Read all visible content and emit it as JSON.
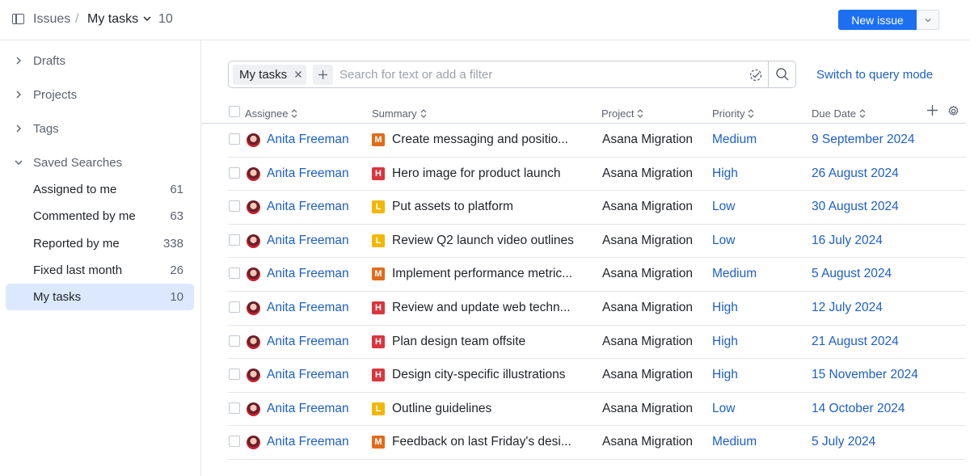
{
  "header": {
    "breadcrumb_root": "Issues",
    "breadcrumb_sep": "/",
    "current_view": "My tasks",
    "count": "10",
    "new_issue_label": "New issue"
  },
  "sidebar": {
    "groups": [
      {
        "label": "Drafts",
        "expanded": false
      },
      {
        "label": "Projects",
        "expanded": false
      },
      {
        "label": "Tags",
        "expanded": false
      },
      {
        "label": "Saved Searches",
        "expanded": true
      }
    ],
    "saved": [
      {
        "label": "Assigned to me",
        "count": "61"
      },
      {
        "label": "Commented by me",
        "count": "63"
      },
      {
        "label": "Reported by me",
        "count": "338"
      },
      {
        "label": "Fixed last month",
        "count": "26"
      },
      {
        "label": "My tasks",
        "count": "10",
        "active": true
      }
    ]
  },
  "search": {
    "chip_label": "My tasks",
    "placeholder": "Search for text or add a filter",
    "switch_mode_label": "Switch to query mode"
  },
  "table": {
    "columns": [
      "Assignee",
      "Summary",
      "Project",
      "Priority",
      "Due Date"
    ],
    "priority_colors": {
      "H": "#d9363e",
      "M": "#e06c1b",
      "L": "#f2b705"
    },
    "rows": [
      {
        "assignee": "Anita Freeman",
        "badge": "M",
        "summary": "Create messaging and positio...",
        "project": "Asana Migration",
        "priority": "Medium",
        "due": "9 September 2024"
      },
      {
        "assignee": "Anita Freeman",
        "badge": "H",
        "summary": "Hero image for product launch",
        "project": "Asana Migration",
        "priority": "High",
        "due": "26 August 2024"
      },
      {
        "assignee": "Anita Freeman",
        "badge": "L",
        "summary": "Put assets to platform",
        "project": "Asana Migration",
        "priority": "Low",
        "due": "30 August 2024"
      },
      {
        "assignee": "Anita Freeman",
        "badge": "L",
        "summary": "Review Q2 launch video outlines",
        "project": "Asana Migration",
        "priority": "Low",
        "due": "16 July 2024"
      },
      {
        "assignee": "Anita Freeman",
        "badge": "M",
        "summary": "Implement performance metric...",
        "project": "Asana Migration",
        "priority": "Medium",
        "due": "5 August 2024"
      },
      {
        "assignee": "Anita Freeman",
        "badge": "H",
        "summary": "Review and update web techn...",
        "project": "Asana Migration",
        "priority": "High",
        "due": "12 July 2024"
      },
      {
        "assignee": "Anita Freeman",
        "badge": "H",
        "summary": "Plan design team offsite",
        "project": "Asana Migration",
        "priority": "High",
        "due": "21 August 2024"
      },
      {
        "assignee": "Anita Freeman",
        "badge": "H",
        "summary": "Design city-specific illustrations",
        "project": "Asana Migration",
        "priority": "High",
        "due": "15 November 2024"
      },
      {
        "assignee": "Anita Freeman",
        "badge": "L",
        "summary": "Outline guidelines",
        "project": "Asana Migration",
        "priority": "Low",
        "due": "14 October 2024"
      },
      {
        "assignee": "Anita Freeman",
        "badge": "M",
        "summary": "Feedback on last Friday's desi...",
        "project": "Asana Migration",
        "priority": "Medium",
        "due": "5 July 2024"
      }
    ]
  }
}
